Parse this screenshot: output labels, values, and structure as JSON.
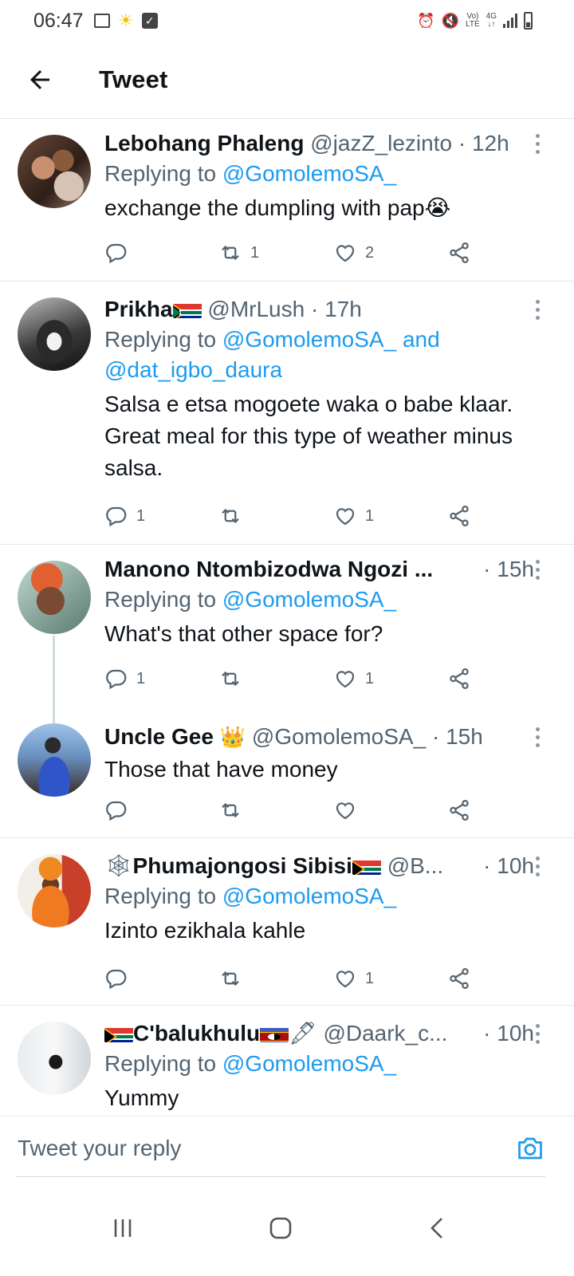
{
  "status_bar": {
    "time": "06:47",
    "network_small_top": "Vo)",
    "network_small_bottom": "LTE",
    "network_4g_top": "4G",
    "network_4g_bottom": "↓↑"
  },
  "header": {
    "title": "Tweet"
  },
  "tweets": [
    {
      "name": "Lebohang Phaleng",
      "handle": "@jazZ_lezinto",
      "time": "· 12h",
      "replying_prefix": "Replying to",
      "mention1": "@GomolemoSA_",
      "mention_join": "",
      "mention2": "",
      "text": "exchange the dumpling with pap😭",
      "reply_count": "",
      "retweet_count": "1",
      "like_count": "2"
    },
    {
      "name": "Prikha",
      "handle": "@MrLush",
      "time": "· 17h",
      "replying_prefix": "Replying to",
      "mention1": "@GomolemoSA_",
      "mention_join": "and",
      "mention2": "@dat_igbo_daura",
      "text": "Salsa e etsa mogoete waka o babe klaar. Great meal for this type of weather minus salsa.",
      "reply_count": "1",
      "retweet_count": "",
      "like_count": "1"
    },
    {
      "name": "Manono Ntombizodwa Ngozi ...",
      "handle": "",
      "time": "· 15h",
      "replying_prefix": "Replying to",
      "mention1": "@GomolemoSA_",
      "text": "What's that other space for?",
      "reply_count": "1",
      "retweet_count": "",
      "like_count": "1"
    },
    {
      "name": "Uncle Gee",
      "name_emoji": "👑",
      "handle": "@GomolemoSA_",
      "time": "· 15h",
      "text": "Those that have money",
      "reply_count": "",
      "retweet_count": "",
      "like_count": ""
    },
    {
      "name_prefix": "🕸",
      "name": "Phumajongosi Sibisi",
      "handle": "@B...",
      "time": "· 10h",
      "replying_prefix": "Replying to",
      "mention1": "@GomolemoSA_",
      "text": "Izinto ezikhala kahle",
      "reply_count": "",
      "retweet_count": "",
      "like_count": "1"
    },
    {
      "name": "C'balukhulu",
      "name_emoji": "🖋",
      "handle": "@Daark_c...",
      "time": "· 10h",
      "replying_prefix": "Replying to",
      "mention1": "@GomolemoSA_",
      "text": "Yummy"
    }
  ],
  "reply_bar": {
    "placeholder": "Tweet your reply"
  },
  "colors": {
    "link": "#1d9bf0",
    "secondary_text": "#536471",
    "divider": "#e6e6e6"
  }
}
